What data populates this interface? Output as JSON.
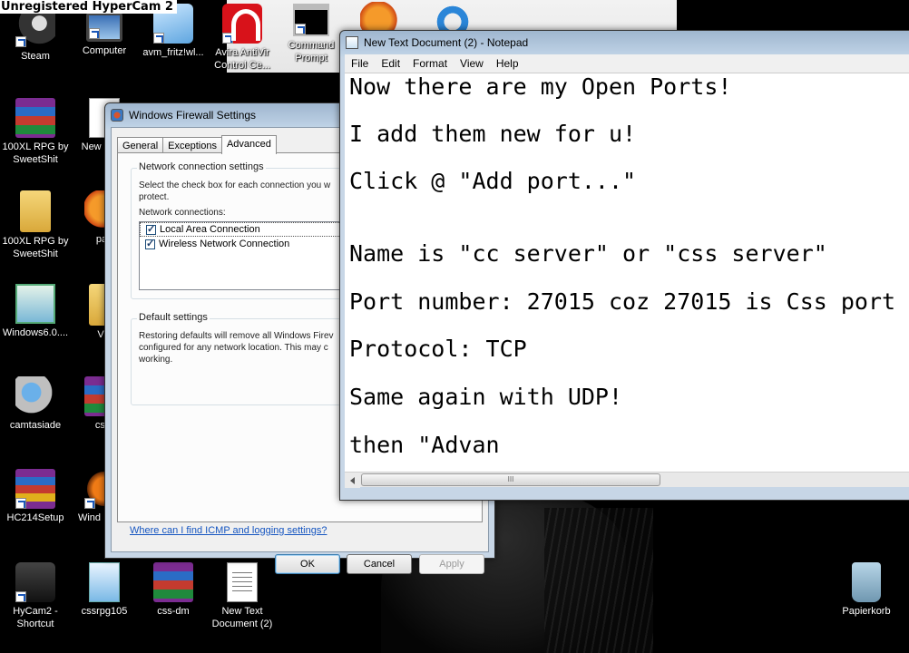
{
  "watermark": "Unregistered HyperCam 2",
  "desktop_icons": [
    {
      "label": "Steam"
    },
    {
      "label": "Computer"
    },
    {
      "label": "avm_fritz!wl..."
    },
    {
      "label": "Avira AntiVir Control Ce..."
    },
    {
      "label": "Command Prompt"
    },
    {
      "label": "100XL RPG by SweetShit"
    },
    {
      "label": "New Docu"
    },
    {
      "label": "100XL RPG by SweetShit"
    },
    {
      "label": "pair"
    },
    {
      "label": "Windows6.0...."
    },
    {
      "label": "VC"
    },
    {
      "label": "camtasiade"
    },
    {
      "label": "css-"
    },
    {
      "label": "HC214Setup"
    },
    {
      "label": "Wind Media"
    },
    {
      "label": "HyCam2 - Shortcut"
    },
    {
      "label": "cssrpg105"
    },
    {
      "label": "css-dm"
    },
    {
      "label": "New Text Document (2)"
    },
    {
      "label": "Papierkorb"
    }
  ],
  "firewall": {
    "title": "Windows Firewall Settings",
    "tabs": [
      {
        "label": "General"
      },
      {
        "label": "Exceptions"
      },
      {
        "label": "Advanced"
      }
    ],
    "network_group_title": "Network connection settings",
    "network_desc_1": "Select the check box for each connection you w",
    "network_desc_2": "protect.",
    "connections_label": "Network connections:",
    "connections": [
      {
        "label": "Local Area Connection",
        "checked": true
      },
      {
        "label": "Wireless Network Connection",
        "checked": true
      }
    ],
    "default_group_title": "Default settings",
    "default_desc_1": "Restoring defaults will remove all Windows Firev",
    "default_desc_2": "configured for any network location. This may c",
    "default_desc_3": "working.",
    "link": "Where can I find ICMP and logging settings?",
    "ok": "OK",
    "cancel": "Cancel",
    "apply": "Apply"
  },
  "notepad": {
    "title": "New Text Document (2) - Notepad",
    "menu": [
      "File",
      "Edit",
      "Format",
      "View",
      "Help"
    ],
    "lines": [
      "Now there are my Open Ports!",
      "I add them new for u!",
      "Click @ \"Add port...\"",
      "Name is \"cc server\" or \"css server\"",
      "Port number: 27015 coz 27015 is Css port",
      "Protocol: TCP",
      "Same again with UDP!",
      "then \"Advan"
    ],
    "scroll_grip": "III"
  }
}
